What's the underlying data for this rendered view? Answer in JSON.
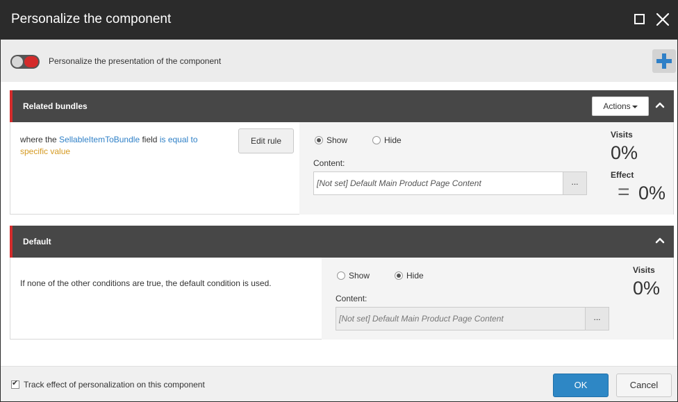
{
  "window": {
    "title": "Personalize the component",
    "maximize_icon": "maximize-icon",
    "close_icon": "close-icon"
  },
  "toggle_row": {
    "label": "Personalize the presentation of the component",
    "toggle_state": "on",
    "add_icon": "plus-icon"
  },
  "rules": [
    {
      "name": "Related bundles",
      "actions_label": "Actions",
      "condition": {
        "prefix": "where the ",
        "field": "SellableItemToBundle",
        "middle": " field ",
        "operator": "is equal to",
        "value": "specific value"
      },
      "edit_rule_label": "Edit rule",
      "show_label": "Show",
      "hide_label": "Hide",
      "selected": "Show",
      "content_label": "Content:",
      "content_value": "[Not set] Default Main Product Page Content",
      "browse_label": "...",
      "visits_label": "Visits",
      "visits_value": "0%",
      "effect_label": "Effect",
      "effect_sign": "=",
      "effect_value": "0%"
    },
    {
      "name": "Default",
      "condition_text": "If none of the other conditions are true, the default condition is used.",
      "show_label": "Show",
      "hide_label": "Hide",
      "selected": "Hide",
      "content_label": "Content:",
      "content_value": "[Not set] Default Main Product Page Content",
      "browse_label": "...",
      "visits_label": "Visits",
      "visits_value": "0%"
    }
  ],
  "footer": {
    "track_label": "Track effect of personalization on this component",
    "track_checked": true,
    "ok_label": "OK",
    "cancel_label": "Cancel"
  },
  "colors": {
    "titlebar": "#2b2b2b",
    "rule_header": "#474747",
    "accent_red": "#d42b2b",
    "link_blue": "#2f80c7",
    "value_orange": "#d59a22",
    "ok_button": "#2e87c5"
  }
}
